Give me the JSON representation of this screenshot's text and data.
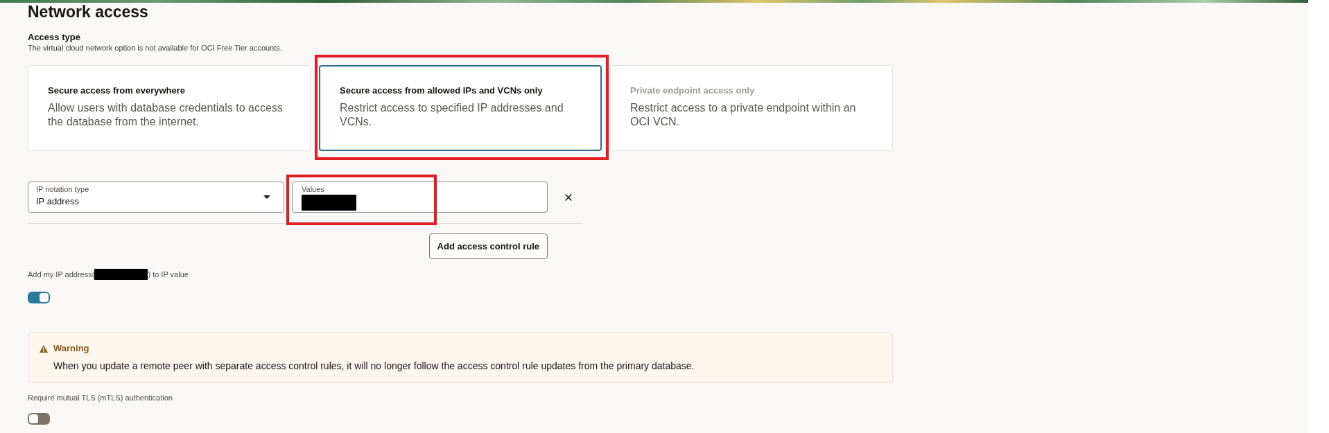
{
  "title": "Network access",
  "access_type": {
    "label": "Access type",
    "help": "The virtual cloud network option is not available for OCI Free Tier accounts.",
    "options": [
      {
        "title": "Secure access from everywhere",
        "description": "Allow users with database credentials to access the database from the internet.",
        "selected": false,
        "disabled": false,
        "highlighted": false
      },
      {
        "title": "Secure access from allowed IPs and VCNs only",
        "description": "Restrict access to specified IP addresses and VCNs.",
        "selected": true,
        "disabled": false,
        "highlighted": true
      },
      {
        "title": "Private endpoint access only",
        "description": "Restrict access to a private endpoint within an OCI VCN.",
        "selected": false,
        "disabled": true,
        "highlighted": false
      }
    ]
  },
  "rule": {
    "fields": [
      {
        "kind": "select",
        "label": "IP notation type",
        "value": "IP address",
        "highlighted": false
      },
      {
        "kind": "text",
        "label": "Values",
        "value_redacted": true,
        "highlighted": true
      }
    ]
  },
  "add_rule_button": "Add access control rule",
  "add_my_ip": {
    "label_before": "Add my IP address(",
    "redacted": true,
    "label_after": ") to IP value",
    "on": true
  },
  "warning": {
    "title": "Warning",
    "message": "When you update a remote peer with separate access control rules, it will no longer follow the access control rule updates from the primary database."
  },
  "mtls": {
    "label": "Require mutual TLS (mTLS) authentication",
    "on": false
  }
}
